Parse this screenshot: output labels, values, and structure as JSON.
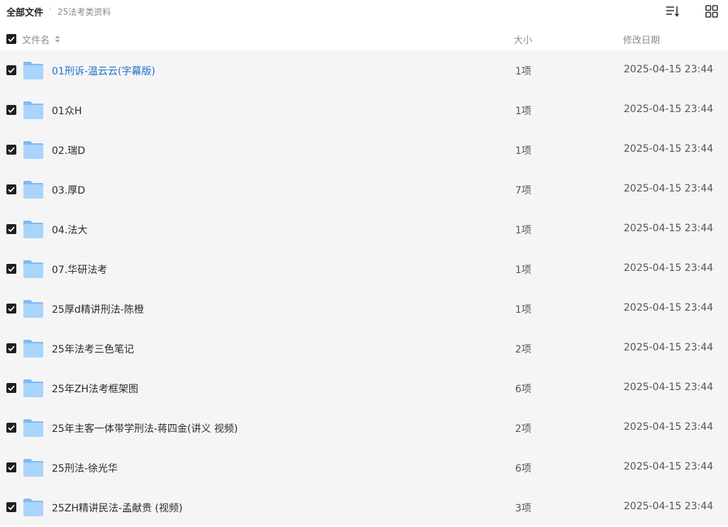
{
  "breadcrumb": {
    "root": "全部文件",
    "separator": "›",
    "current": "25法考类资料"
  },
  "toolbar": {
    "sort_icon": "sort-list-icon",
    "view_icon": "grid-view-icon"
  },
  "table": {
    "headers": {
      "name": "文件名",
      "size": "大小",
      "date": "修改日期"
    },
    "rows": [
      {
        "name": "01刑诉-温云云(字幕版)",
        "size": "1项",
        "date": "2025-04-15 23:44",
        "checked": true
      },
      {
        "name": "01众H",
        "size": "1项",
        "date": "2025-04-15 23:44",
        "checked": true
      },
      {
        "name": "02.瑞D",
        "size": "1项",
        "date": "2025-04-15 23:44",
        "checked": true
      },
      {
        "name": "03.厚D",
        "size": "7项",
        "date": "2025-04-15 23:44",
        "checked": true
      },
      {
        "name": "04.法大",
        "size": "1项",
        "date": "2025-04-15 23:44",
        "checked": true
      },
      {
        "name": "07.华研法考",
        "size": "1项",
        "date": "2025-04-15 23:44",
        "checked": true
      },
      {
        "name": "25厚d精讲刑法-陈橙",
        "size": "1项",
        "date": "2025-04-15 23:44",
        "checked": true
      },
      {
        "name": "25年法考三色笔记",
        "size": "2项",
        "date": "2025-04-15 23:44",
        "checked": true
      },
      {
        "name": "25年ZH法考框架图",
        "size": "6项",
        "date": "2025-04-15 23:44",
        "checked": true
      },
      {
        "name": "25年主客一体带学刑法-蒋四金(讲义 视频)",
        "size": "2项",
        "date": "2025-04-15 23:44",
        "checked": true
      },
      {
        "name": "25刑法-徐光华",
        "size": "6项",
        "date": "2025-04-15 23:44",
        "checked": true
      },
      {
        "name": "25ZH精讲民法-孟献贵 (视频)",
        "size": "3项",
        "date": "2025-04-15 23:44",
        "checked": true
      }
    ]
  },
  "colors": {
    "checkbox": "#1f1f1f",
    "list_bg": "#f5f5f5",
    "link": "#1f6fd1",
    "folder_light": "#a9d4fb",
    "folder_dark": "#7fbaf4"
  }
}
